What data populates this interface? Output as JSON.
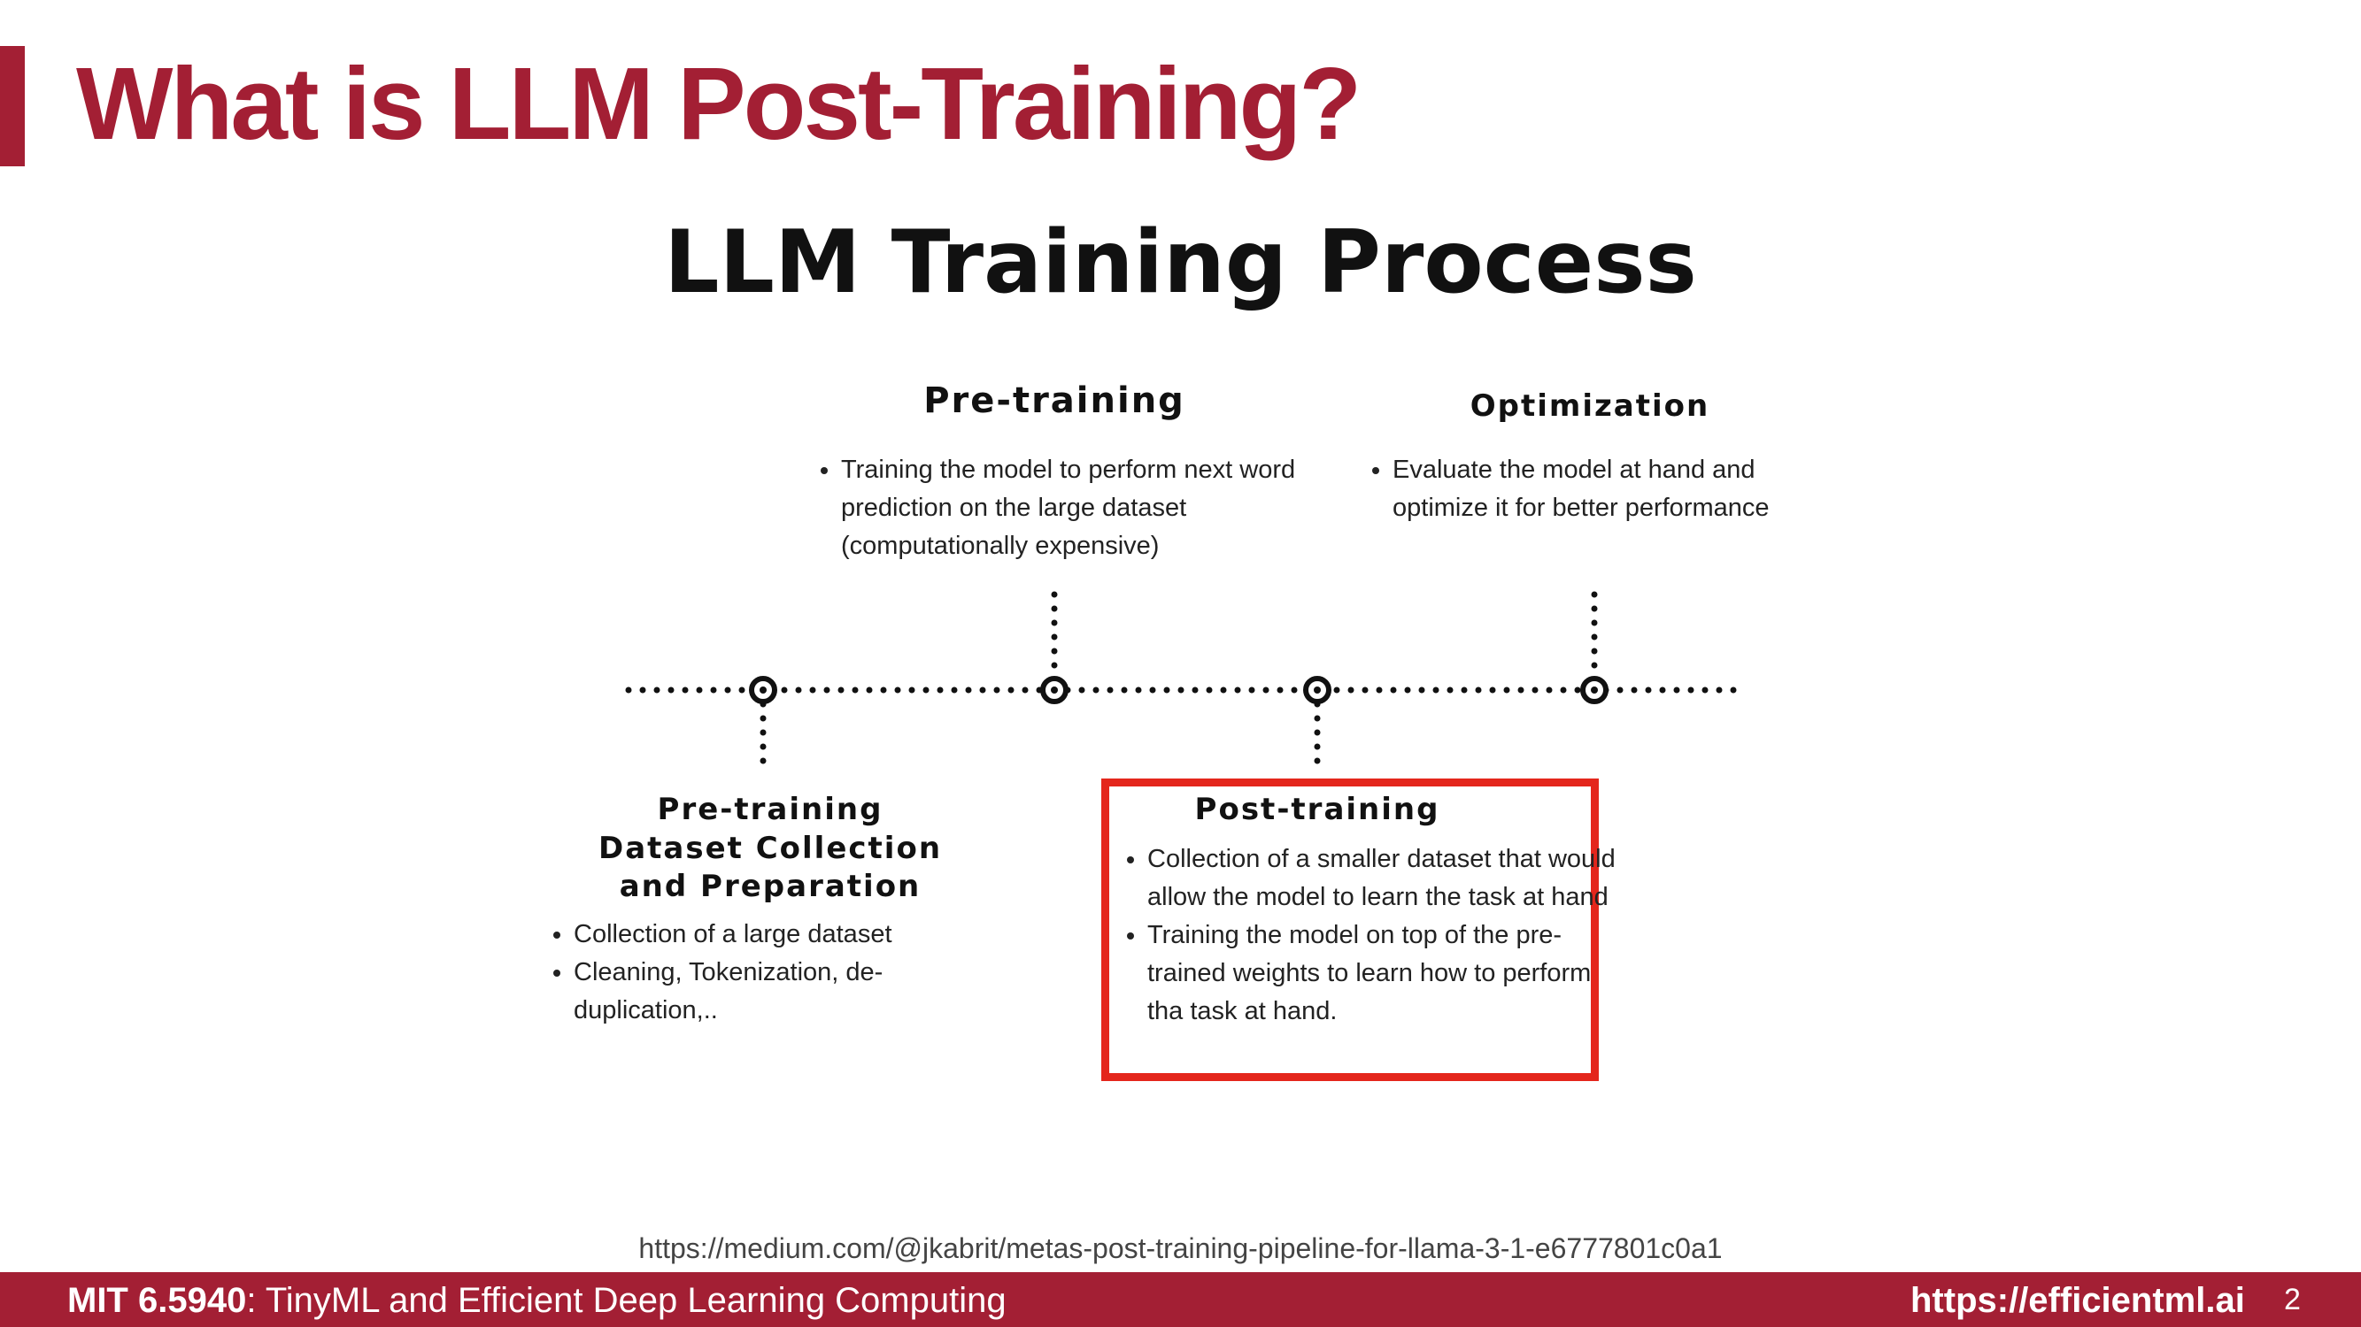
{
  "slide": {
    "title": "What is LLM Post-Training?",
    "accent_color": "#a31f34"
  },
  "diagram": {
    "title": "LLM Training Process",
    "stages": {
      "dataset": {
        "heading_line1": "Pre-training",
        "heading_line2": "Dataset Collection",
        "heading_line3": "and Preparation",
        "bullets": [
          "Collection of a large dataset",
          "Cleaning, Tokenization, de-duplication,.."
        ]
      },
      "pretraining": {
        "heading": "Pre-training",
        "bullets": [
          "Training the model to perform next word prediction on the large dataset (computationally expensive)"
        ]
      },
      "posttraining": {
        "heading": "Post-training",
        "bullets": [
          "Collection of a smaller dataset that would allow the model to learn the task at hand",
          "Training the model on top of the pre-trained weights to learn how to perform tha task at hand."
        ],
        "highlight_color": "#e4261c"
      },
      "optimization": {
        "heading": "Optimization",
        "bullets": [
          "Evaluate the model at hand and optimize it for better performance"
        ]
      }
    }
  },
  "source_url": "https://medium.com/@jkabrit/metas-post-training-pipeline-for-llama-3-1-e6777801c0a1",
  "footer": {
    "course_code": "MIT 6.5940",
    "course_name": ": TinyML and Efficient Deep Learning Computing",
    "url": "https://efficientml.ai",
    "page_number": "2"
  }
}
